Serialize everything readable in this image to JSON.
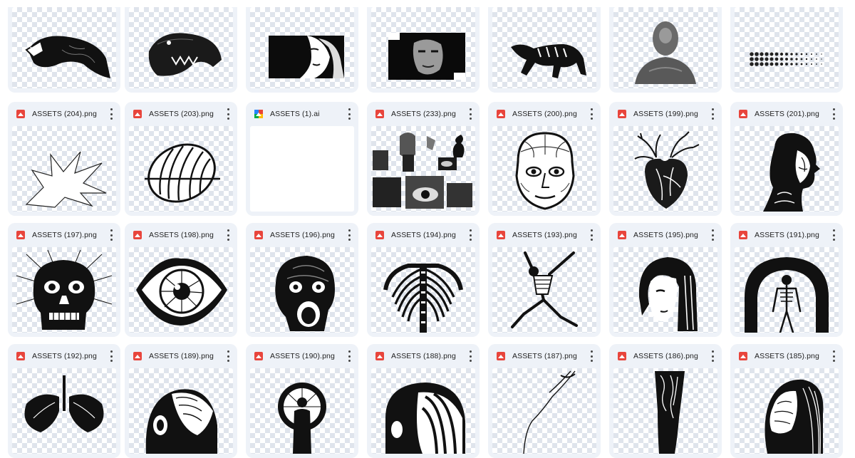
{
  "files": {
    "row0": [
      {
        "name": "",
        "icon": "snake-head-image"
      },
      {
        "name": "",
        "icon": "crocodile-head-image"
      },
      {
        "name": "",
        "icon": "woman-face-rectangle-image"
      },
      {
        "name": "",
        "icon": "woman-face-dark-image"
      },
      {
        "name": "",
        "icon": "running-tiger-image"
      },
      {
        "name": "",
        "icon": "blurred-bust-image"
      },
      {
        "name": "",
        "icon": "halftone-dots-image"
      }
    ],
    "row1": [
      {
        "name": "ASSETS (204).png",
        "icon": "explosion-shape-image"
      },
      {
        "name": "ASSETS (203).png",
        "icon": "striped-oval-planet-image"
      },
      {
        "name": "ASSETS (1).ai",
        "icon": "blank-illustrator-file"
      },
      {
        "name": "ASSETS (233).png",
        "icon": "collage-statues-image"
      },
      {
        "name": "ASSETS (200).png",
        "icon": "anatomical-head-image"
      },
      {
        "name": "ASSETS (199).png",
        "icon": "anatomical-heart-image"
      },
      {
        "name": "ASSETS (201).png",
        "icon": "profile-head-anatomy-image"
      }
    ],
    "row2": [
      {
        "name": "ASSETS (197).png",
        "icon": "skull-rays-image"
      },
      {
        "name": "ASSETS (198).png",
        "icon": "eye-engraving-image"
      },
      {
        "name": "ASSETS (196).png",
        "icon": "screaming-skull-image"
      },
      {
        "name": "ASSETS (194).png",
        "icon": "ribcage-spine-image"
      },
      {
        "name": "ASSETS (193).png",
        "icon": "dancing-skeleton-image"
      },
      {
        "name": "ASSETS (195).png",
        "icon": "woman-bob-hair-image"
      },
      {
        "name": "ASSETS (191).png",
        "icon": "skeleton-arch-image"
      }
    ],
    "row3": [
      {
        "name": "ASSETS (192).png",
        "icon": "lungs-tree-image"
      },
      {
        "name": "ASSETS (189).png",
        "icon": "head-brain-image"
      },
      {
        "name": "ASSETS (190).png",
        "icon": "figure-halo-image"
      },
      {
        "name": "ASSETS (188).png",
        "icon": "striped-face-image"
      },
      {
        "name": "ASSETS (187).png",
        "icon": "line-figure-image"
      },
      {
        "name": "ASSETS (186).png",
        "icon": "tree-trunk-image"
      },
      {
        "name": "ASSETS (185).png",
        "icon": "woman-profile-lines-image"
      }
    ]
  },
  "colors": {
    "card_bg": "#eef2f8",
    "pdf_icon": "#e8453c",
    "ai_icon_blue": "#2684fc",
    "ai_icon_green": "#00ac47",
    "ai_icon_yellow": "#ffba00",
    "ai_icon_red": "#ea4335"
  }
}
